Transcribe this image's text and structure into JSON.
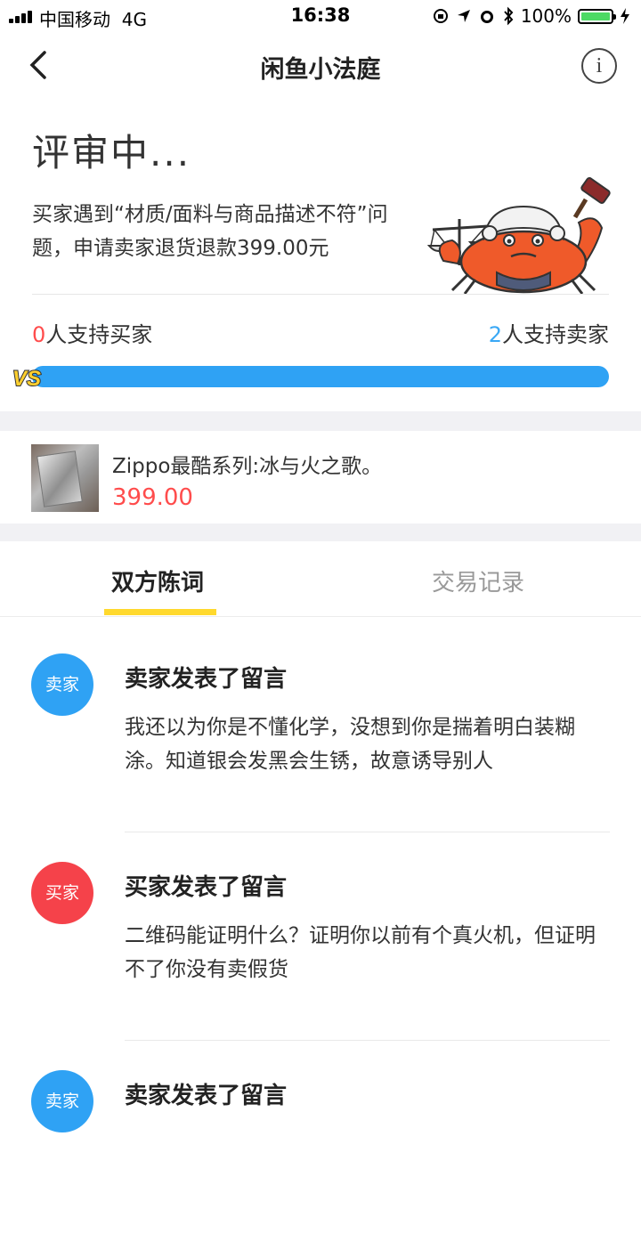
{
  "status_bar": {
    "carrier": "中国移动",
    "network": "4G",
    "time": "16:38",
    "battery_pct": "100%"
  },
  "nav": {
    "title": "闲鱼小法庭",
    "info_glyph": "i"
  },
  "case": {
    "status_title": "评审中...",
    "description": "买家遇到“材质/面料与商品描述不符”问题，申请卖家退货退款399.00元",
    "support_buyer_count": "0",
    "support_buyer_label": "人支持买家",
    "support_seller_count": "2",
    "support_seller_label": "人支持卖家",
    "vs_label": "VS"
  },
  "product": {
    "name": "Zippo最酷系列:冰与火之歌。",
    "price": "399.00"
  },
  "tabs": [
    {
      "label": "双方陈词",
      "active": true
    },
    {
      "label": "交易记录",
      "active": false
    }
  ],
  "messages": [
    {
      "avatar_label": "卖家",
      "avatar_color": "#2fa2f4",
      "title": "卖家发表了留言",
      "text": "我还以为你是不懂化学，没想到你是揣着明白装糊涂。知道银会发黑会生锈，故意诱导别人"
    },
    {
      "avatar_label": "买家",
      "avatar_color": "#f5424a",
      "title": "买家发表了留言",
      "text": "二维码能证明什么？证明你以前有个真火机，但证明不了你没有卖假货"
    },
    {
      "avatar_label": "卖家",
      "avatar_color": "#2fa2f4",
      "title": "卖家发表了留言",
      "text": ""
    }
  ],
  "colors": {
    "buyer_red": "#ff4c4c",
    "seller_blue": "#2fa2f4",
    "tab_indicator": "#ffd92e"
  },
  "icons": {
    "back": "back-chevron-icon",
    "info": "info-icon",
    "signal": "signal-icon",
    "mascot": "crab-judge-icon"
  }
}
